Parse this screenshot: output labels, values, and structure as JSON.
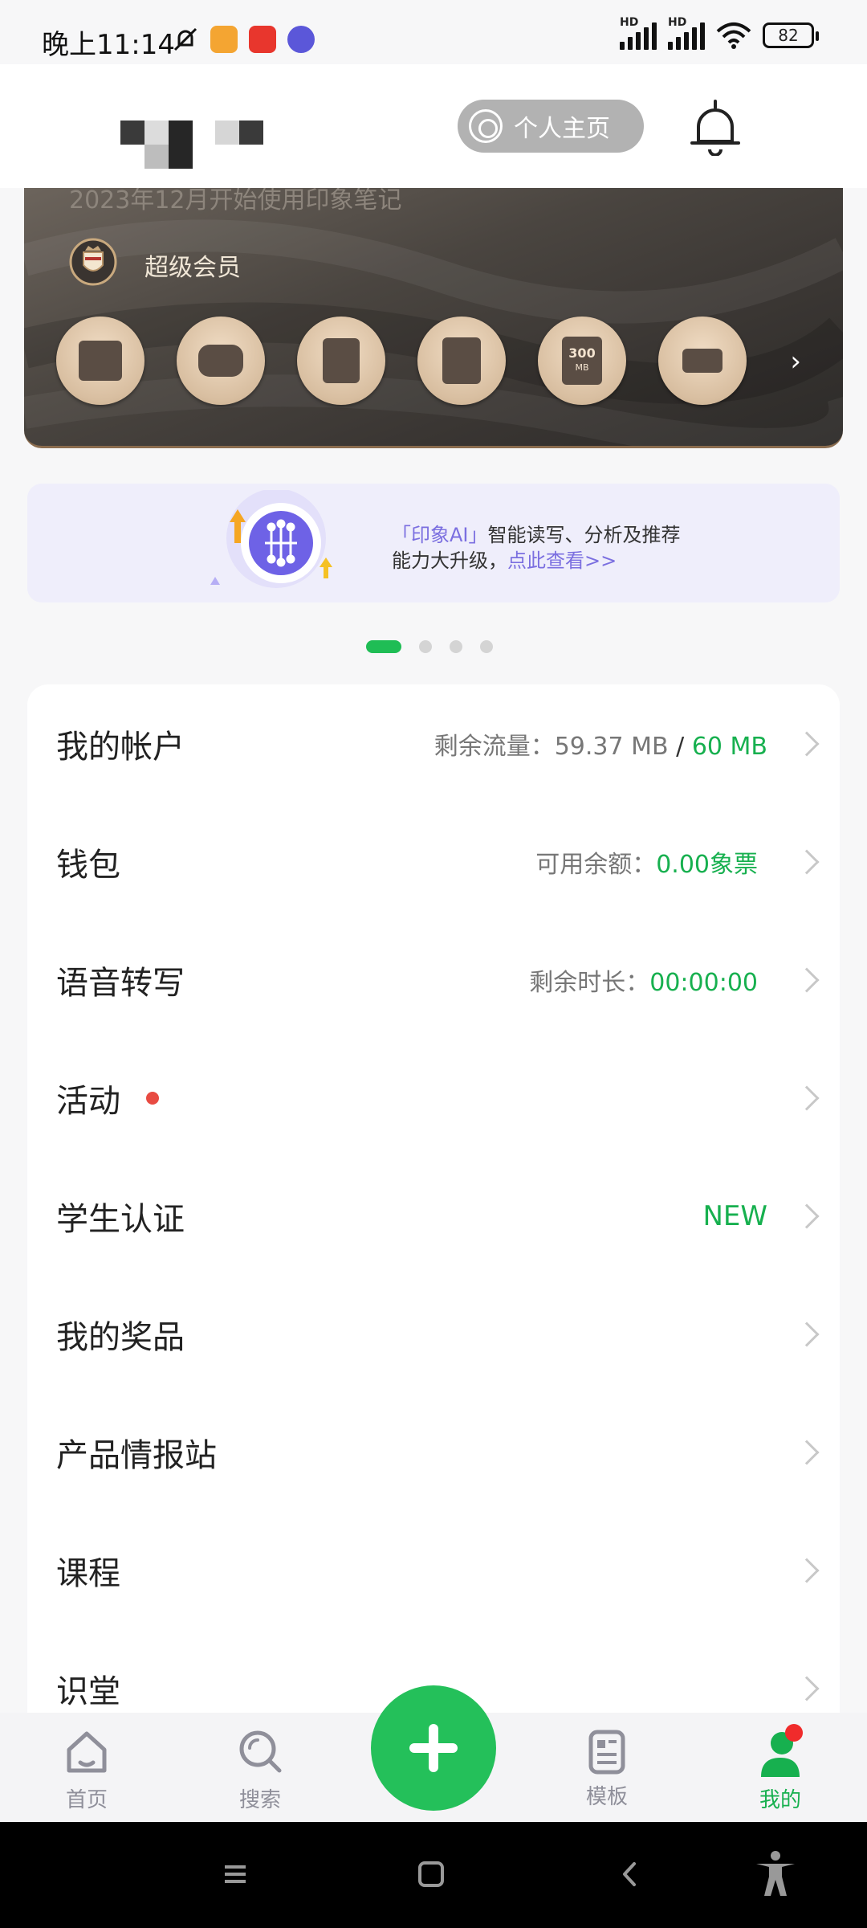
{
  "status_bar": {
    "time": "晚上11:14",
    "battery": "82",
    "hd_labels": [
      "HD",
      "HD"
    ],
    "app_icon_colors": [
      "#f4a532",
      "#e8362d",
      "#5b57d9"
    ]
  },
  "header": {
    "homepage_label": "个人主页",
    "icons": [
      "face-icon",
      "bell-icon"
    ]
  },
  "member_card": {
    "since_text": "2023年12月开始使用印象笔记",
    "member_label": "超级会员",
    "benefit_icons": [
      "sync-icon",
      "mindmap-icon",
      "template-icon",
      "evernote-icon",
      "storage-icon",
      "scan-icon"
    ],
    "storage_label": "300",
    "storage_unit": "MB",
    "more": "›"
  },
  "ai_banner": {
    "tag": "「印象AI」",
    "line1": "智能读写、分析及推荐",
    "line2": "能力大升级，",
    "link": "点此查看>>"
  },
  "pager": {
    "count": 4,
    "active": 0
  },
  "list": {
    "account": {
      "label": "我的帐户",
      "prefix": "剩余流量：",
      "value": "59.37 MB",
      "sep": "/",
      "total": "60 MB"
    },
    "wallet": {
      "label": "钱包",
      "prefix": "可用余额：",
      "value": "0.00象票"
    },
    "transcribe": {
      "label": "语音转写",
      "prefix": "剩余时长：",
      "value": "00:00:00"
    },
    "events": {
      "label": "活动"
    },
    "student": {
      "label": "学生认证",
      "badge": "NEW"
    },
    "prizes": {
      "label": "我的奖品"
    },
    "product_news": {
      "label": "产品情报站"
    },
    "courses": {
      "label": "课程"
    },
    "knowledge": {
      "label": "识堂"
    }
  },
  "tabbar": {
    "home": "首页",
    "search": "搜索",
    "templates": "模板",
    "mine": "我的",
    "accent_color": "#17b04f"
  },
  "system_nav": [
    "menu-icon",
    "home-square-icon",
    "back-icon",
    "accessibility-icon"
  ]
}
